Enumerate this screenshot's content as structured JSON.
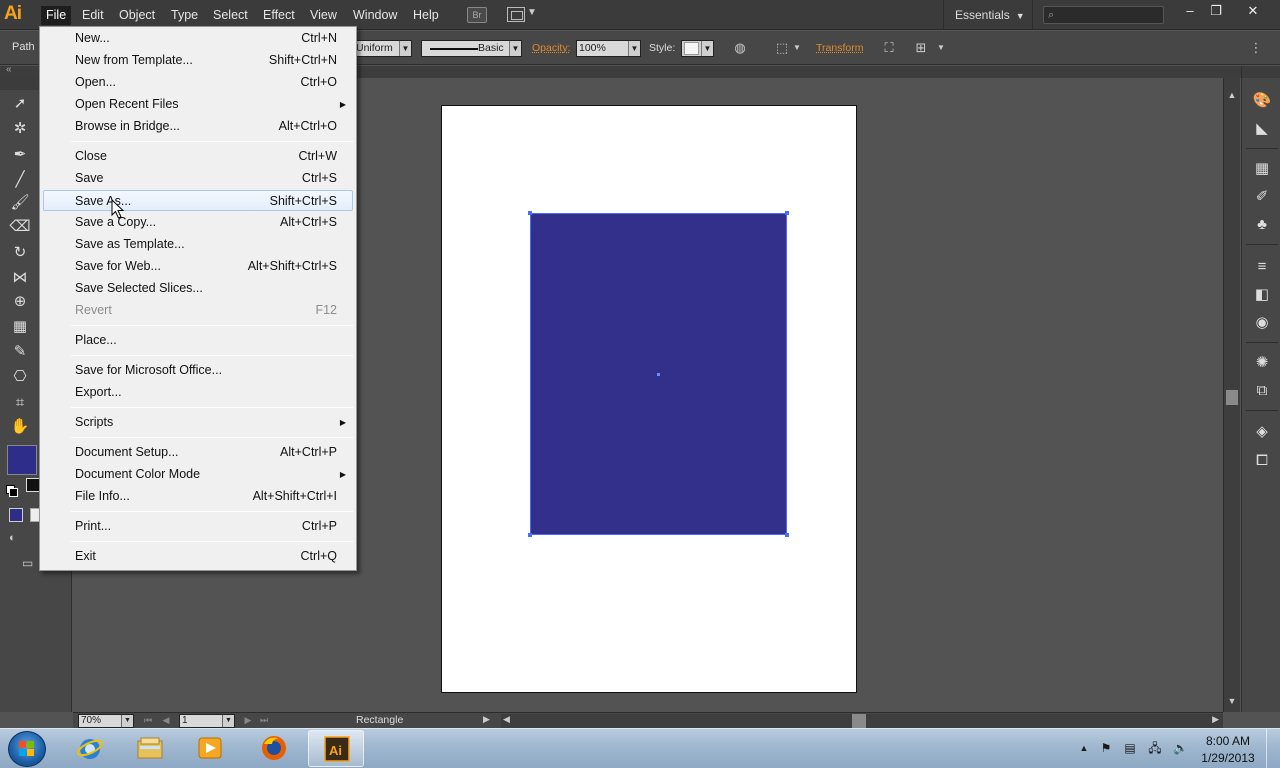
{
  "app": {
    "logo": "Ai",
    "menus": [
      "File",
      "Edit",
      "Object",
      "Type",
      "Select",
      "Effect",
      "View",
      "Window",
      "Help"
    ],
    "bridge_label": "Br",
    "workspace": "Essentials",
    "search_placeholder": "",
    "window_controls": [
      "–",
      "❐",
      "✕"
    ]
  },
  "controlbar": {
    "selection_type": "Path",
    "stroke_profile": "Uniform",
    "brush": "Basic",
    "opacity_label": "Opacity:",
    "opacity_value": "100%",
    "style_label": "Style:",
    "transform_label": "Transform"
  },
  "file_menu": {
    "items": [
      {
        "label": "New...",
        "shortcut": "Ctrl+N"
      },
      {
        "label": "New from Template...",
        "shortcut": "Shift+Ctrl+N"
      },
      {
        "label": "Open...",
        "shortcut": "Ctrl+O"
      },
      {
        "label": "Open Recent Files",
        "shortcut": ""
      },
      {
        "label": "Browse in Bridge...",
        "shortcut": "Alt+Ctrl+O"
      },
      {
        "label": "Close",
        "shortcut": "Ctrl+W"
      },
      {
        "label": "Save",
        "shortcut": "Ctrl+S"
      },
      {
        "label": "Save As...",
        "shortcut": "Shift+Ctrl+S"
      },
      {
        "label": "Save a Copy...",
        "shortcut": "Alt+Ctrl+S"
      },
      {
        "label": "Save as Template...",
        "shortcut": ""
      },
      {
        "label": "Save for Web...",
        "shortcut": "Alt+Shift+Ctrl+S"
      },
      {
        "label": "Save Selected Slices...",
        "shortcut": ""
      },
      {
        "label": "Revert",
        "shortcut": "F12"
      },
      {
        "label": "Place...",
        "shortcut": ""
      },
      {
        "label": "Save for Microsoft Office...",
        "shortcut": ""
      },
      {
        "label": "Export...",
        "shortcut": ""
      },
      {
        "label": "Scripts",
        "shortcut": ""
      },
      {
        "label": "Document Setup...",
        "shortcut": "Alt+Ctrl+P"
      },
      {
        "label": "Document Color Mode",
        "shortcut": ""
      },
      {
        "label": "File Info...",
        "shortcut": "Alt+Shift+Ctrl+I"
      },
      {
        "label": "Print...",
        "shortcut": "Ctrl+P"
      },
      {
        "label": "Exit",
        "shortcut": "Ctrl+Q"
      }
    ],
    "submenu_arrow": "▶"
  },
  "statusbar": {
    "zoom": "70%",
    "page": "1",
    "status": "Rectangle"
  },
  "colors": {
    "fill": "#32308a",
    "accent_orange": "#f7a21b",
    "selection": "#4a6cff"
  },
  "taskbar": {
    "apps": [
      "internet-explorer-icon",
      "windows-explorer-icon",
      "media-player-icon",
      "firefox-icon",
      "illustrator-icon"
    ],
    "illustrator_label": "Ai",
    "time": "8:00 AM",
    "date": "1/29/2013"
  }
}
